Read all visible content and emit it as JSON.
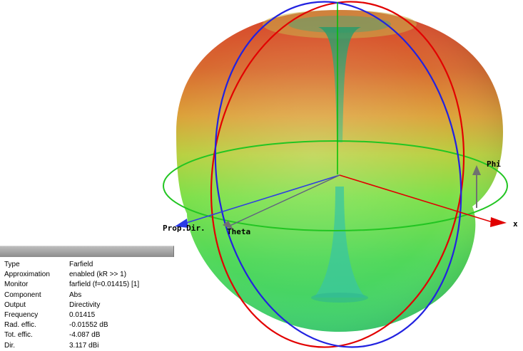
{
  "axes": {
    "x": "x",
    "phi": "Phi",
    "theta": "Theta",
    "prop_dir": "Prop.Dir."
  },
  "info": {
    "rows": [
      {
        "key": "Type",
        "value": "Farfield"
      },
      {
        "key": "Approximation",
        "value": "enabled (kR >> 1)"
      },
      {
        "key": "Monitor",
        "value": "farfield (f=0.01415) [1]"
      },
      {
        "key": "Component",
        "value": "Abs"
      },
      {
        "key": "Output",
        "value": "Directivity"
      },
      {
        "key": "Frequency",
        "value": "0.01415"
      },
      {
        "key": "Rad. effic.",
        "value": "-0.01552 dB"
      },
      {
        "key": "Tot. effic.",
        "value": "-4.087 dB"
      },
      {
        "key": "Dir.",
        "value": "3.117 dBi"
      }
    ]
  },
  "colors": {
    "x_axis": "#e00000",
    "prop_dir_axis": "#1f2ad8",
    "z_axis": "#00c000",
    "ring_red": "#e00000",
    "ring_blue": "#2020e0",
    "ring_green": "#20c020",
    "pattern_top": "#d83a2a",
    "pattern_mid": "#e8a030",
    "pattern_bottom": "#40d040"
  }
}
